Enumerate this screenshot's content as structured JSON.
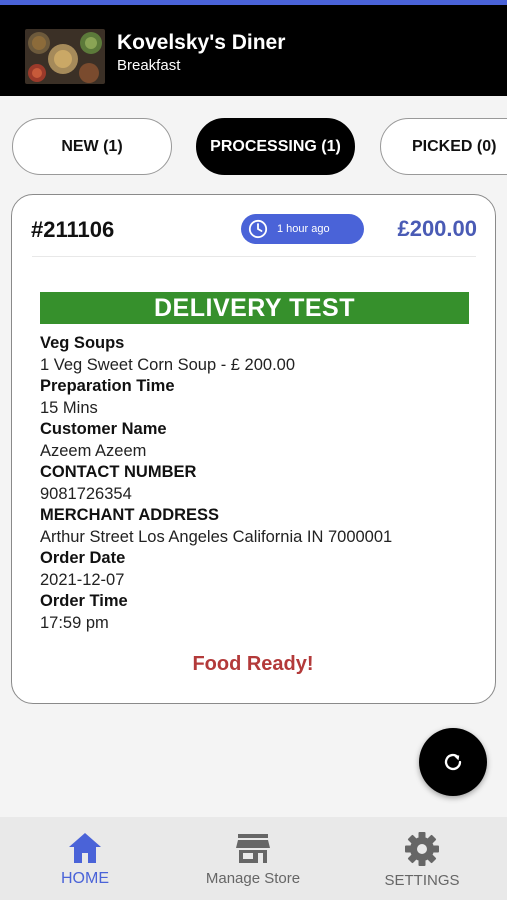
{
  "colors": {
    "accent": "#4a63d8",
    "banner_green": "#36902c",
    "food_ready_red": "#b33a3a",
    "header_bg": "#000000"
  },
  "header": {
    "title": "Kovelsky's Diner",
    "subtitle": "Breakfast"
  },
  "tabs": [
    {
      "label": "NEW (1)",
      "active": false
    },
    {
      "label": "PROCESSING (1)",
      "active": true
    },
    {
      "label": "PICKED (0)",
      "active": false
    }
  ],
  "order": {
    "id": "#211106",
    "time_ago": "1 hour ago",
    "total": "£200.00",
    "banner": "DELIVERY TEST",
    "details": [
      {
        "label": "Veg Soups",
        "value": "1 Veg Sweet Corn Soup - £ 200.00"
      },
      {
        "label": "Preparation Time",
        "value": "15 Mins"
      },
      {
        "label": "Customer Name",
        "value": "Azeem Azeem"
      },
      {
        "label": "CONTACT NUMBER",
        "value": "9081726354"
      },
      {
        "label": "MERCHANT ADDRESS",
        "value": "Arthur Street Los Angeles California IN 7000001"
      },
      {
        "label": "Order Date",
        "value": "2021-12-07"
      },
      {
        "label": "Order Time",
        "value": "17:59 pm"
      }
    ],
    "status_action": "Food Ready!"
  },
  "fab_icon": "refresh-icon",
  "bottom_nav": [
    {
      "label": "HOME",
      "icon": "home-icon",
      "active": true
    },
    {
      "label": "Manage Store",
      "icon": "store-icon",
      "active": false
    },
    {
      "label": "SETTINGS",
      "icon": "gear-icon",
      "active": false
    }
  ]
}
